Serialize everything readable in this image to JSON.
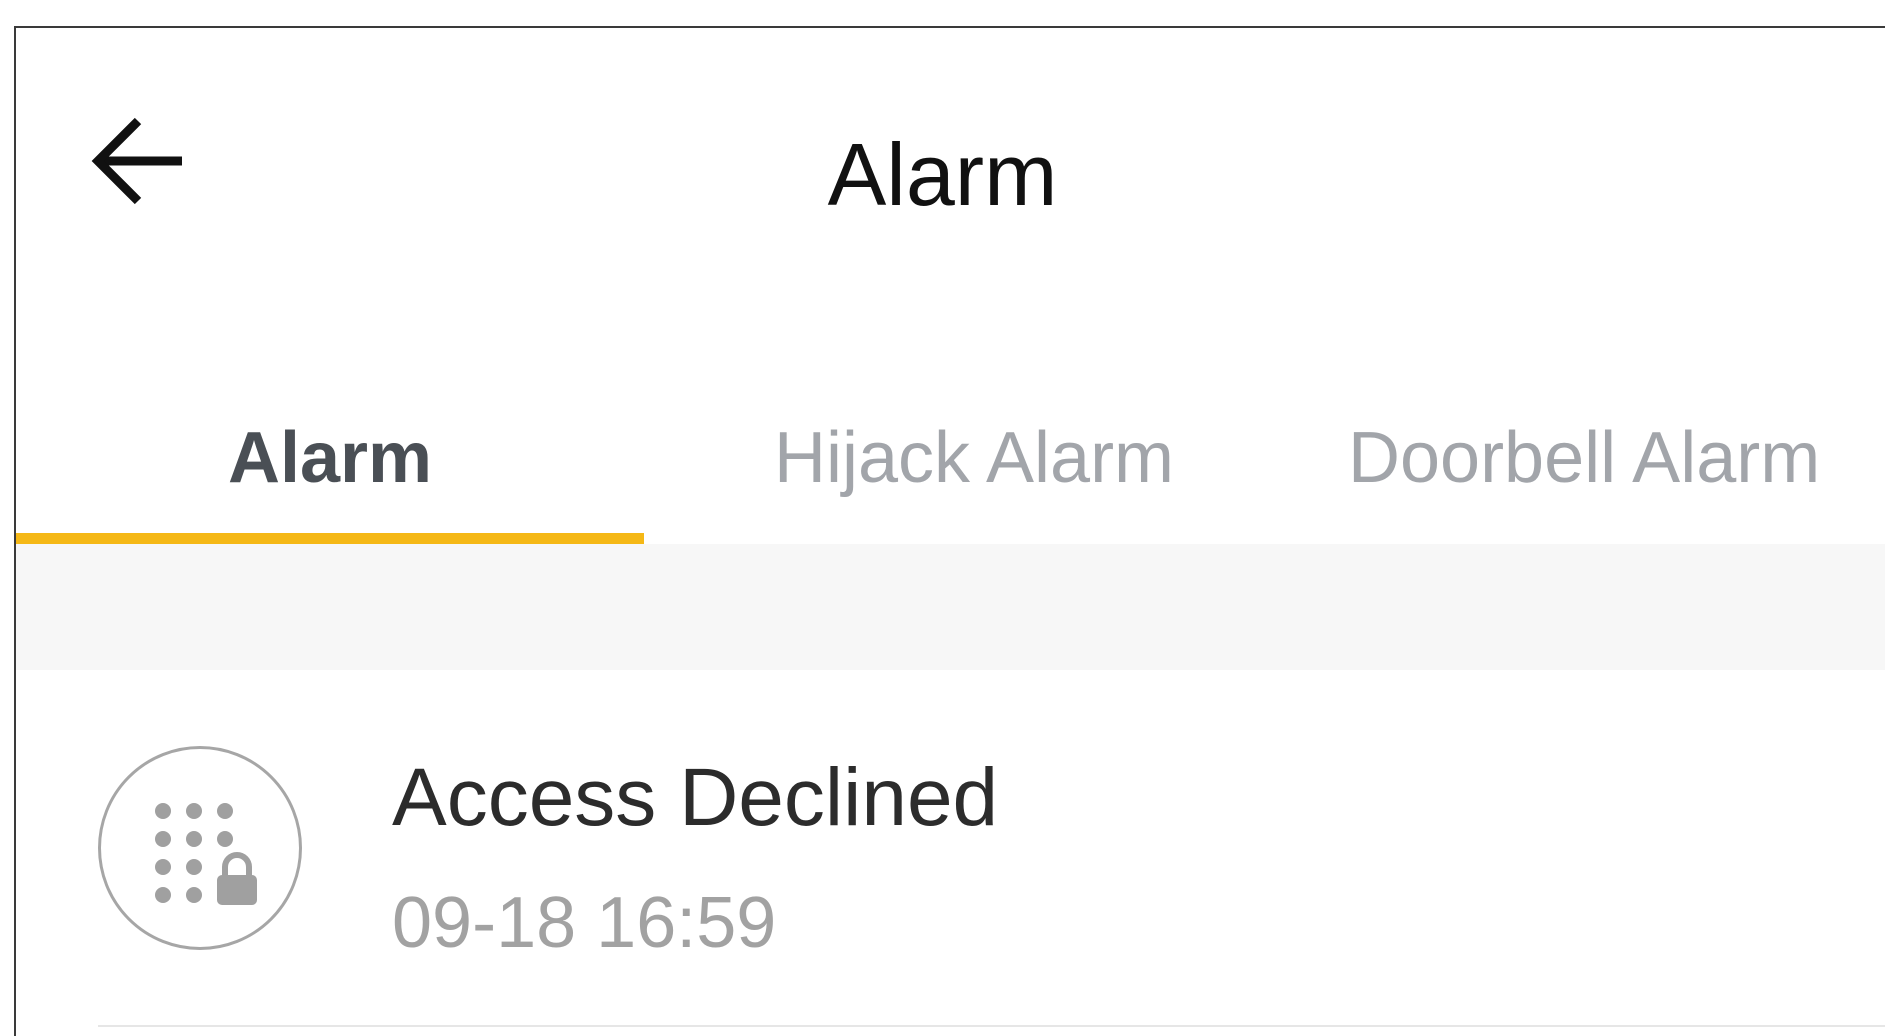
{
  "header": {
    "title": "Alarm",
    "back_icon": "arrow-left-icon"
  },
  "tabs": [
    {
      "label": "Alarm",
      "active": true
    },
    {
      "label": "Hijack Alarm",
      "active": false
    },
    {
      "label": "Doorbell Alarm",
      "active": false
    }
  ],
  "colors": {
    "accent": "#f5b816",
    "active_tab_text": "#4a4f55",
    "inactive_tab_text": "#a2a5aa"
  },
  "alarms": [
    {
      "icon": "keypad-lock-icon",
      "title": "Access Declined",
      "time": "09-18 16:59"
    }
  ]
}
